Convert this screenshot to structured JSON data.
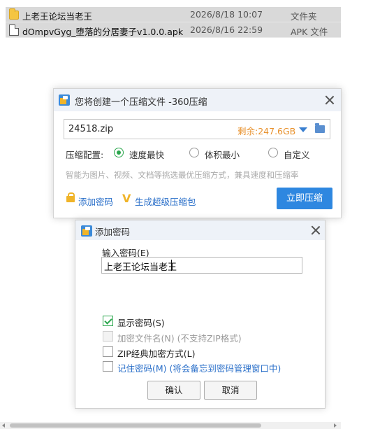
{
  "files": [
    {
      "name": "上老王论坛当老王",
      "date": "2026/8/18 10:07",
      "type": "文件夹",
      "icon": "folder-icon"
    },
    {
      "name": "dOmpvGyg_堕落的分居妻子v1.0.0.apk",
      "date": "2026/8/16 22:59",
      "type": "APK 文件",
      "icon": "file-icon"
    }
  ],
  "compress_dialog": {
    "title": "您将创建一个压缩文件 -360压缩",
    "filename": "24518.zip",
    "free_space": "剩余:247.6GB",
    "config_label": "压缩配置:",
    "options": [
      "速度最快",
      "体积最小",
      "自定义"
    ],
    "selected_option": "速度最快",
    "hint": "智能为图片、视频、文档等挑选最优压缩方式，兼具速度和压缩率",
    "add_password_link": "添加密码",
    "super_package_link": "生成超级压缩包",
    "compress_button": "立即压缩",
    "accent_color": "#2e87e0"
  },
  "password_dialog": {
    "title": "添加密码",
    "input_label": "输入密码(E)",
    "password_value": "上老王论坛当老王",
    "checkboxes": [
      {
        "label": "显示密码(S)",
        "checked": true,
        "disabled": false
      },
      {
        "label": "加密文件名(N) (不支持ZIP格式)",
        "checked": false,
        "disabled": true
      },
      {
        "label": "ZIP经典加密方式(L)",
        "checked": false,
        "disabled": false
      },
      {
        "label": "记住密码(M) (将会备忘到密码管理窗口中)",
        "checked": false,
        "disabled": false
      }
    ],
    "ok_button": "确认",
    "cancel_button": "取消"
  }
}
